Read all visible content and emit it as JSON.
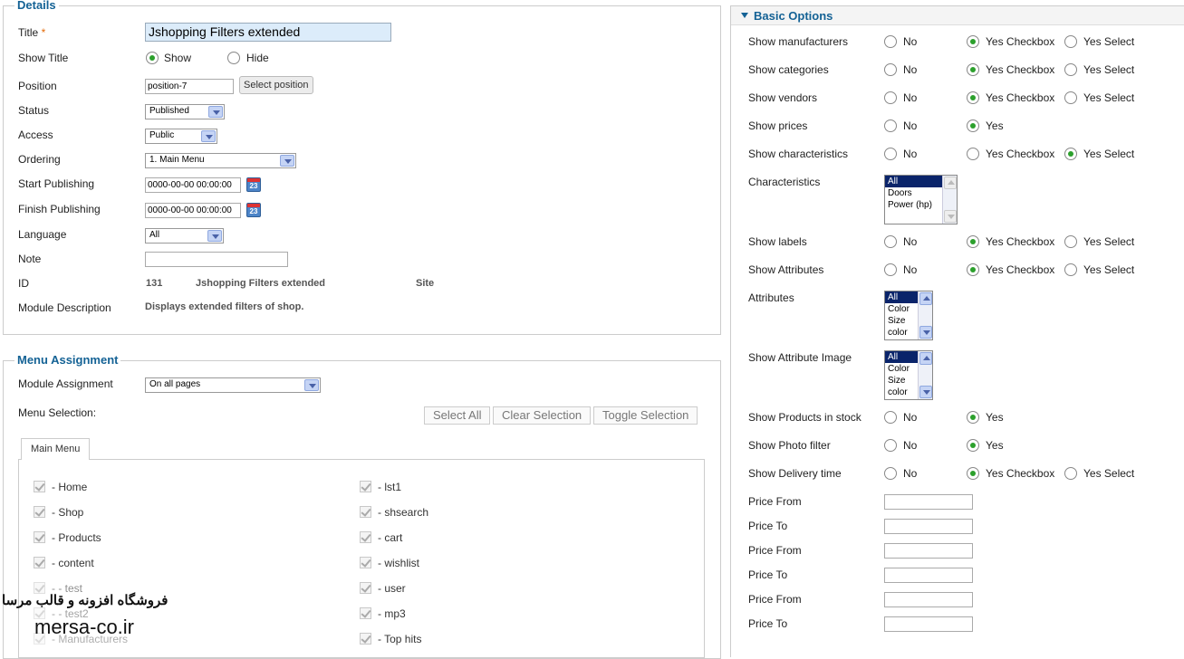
{
  "details": {
    "legend": "Details",
    "title_label": "Title",
    "title_required": "*",
    "title_value": "Jshopping Filters extended",
    "show_title_label": "Show Title",
    "show_option": "Show",
    "hide_option": "Hide",
    "position_label": "Position",
    "position_value": "position-7",
    "select_position_button": "Select position",
    "status_label": "Status",
    "status_value": "Published",
    "access_label": "Access",
    "access_value": "Public",
    "ordering_label": "Ordering",
    "ordering_value": "1. Main Menu",
    "start_label": "Start Publishing",
    "start_value": "0000-00-00 00:00:00",
    "finish_label": "Finish Publishing",
    "finish_value": "0000-00-00 00:00:00",
    "calendar_day": "23",
    "language_label": "Language",
    "language_value": "All",
    "note_label": "Note",
    "note_value": "",
    "id_label": "ID",
    "id_value": "131",
    "id_name": "Jshopping Filters extended",
    "id_site": "Site",
    "desc_label": "Module Description",
    "desc_value": "Displays extended filters of shop."
  },
  "menu_assignment": {
    "legend": "Menu Assignment",
    "module_assignment_label": "Module Assignment",
    "module_assignment_value": "On all pages",
    "menu_selection_label": "Menu Selection:",
    "select_all": "Select All",
    "clear_selection": "Clear Selection",
    "toggle_selection": "Toggle Selection",
    "tab_main_menu": "Main Menu",
    "left_items": [
      "- Home",
      "- Shop",
      "- Products",
      "- content",
      "- - test",
      "- - test2",
      "- Manufacturers"
    ],
    "right_items": [
      "- lst1",
      "- shsearch",
      "- cart",
      "- wishlist",
      "- user",
      "- mp3",
      "- Top hits"
    ]
  },
  "basic_options": {
    "title": "Basic Options",
    "rows": [
      {
        "label": "Show manufacturers",
        "no": "No",
        "yes": "Yes Checkbox",
        "select": "Yes Select",
        "selected": "yes"
      },
      {
        "label": "Show categories",
        "no": "No",
        "yes": "Yes Checkbox",
        "select": "Yes Select",
        "selected": "yes"
      },
      {
        "label": "Show vendors",
        "no": "No",
        "yes": "Yes Checkbox",
        "select": "Yes Select",
        "selected": "yes"
      },
      {
        "label": "Show prices",
        "no": "No",
        "yes": "Yes",
        "select": "",
        "selected": "yes"
      },
      {
        "label": "Show characteristics",
        "no": "No",
        "yes": "Yes Checkbox",
        "select": "Yes Select",
        "selected": "select"
      }
    ],
    "characteristics_label": "Characteristics",
    "characteristics_options": [
      "All",
      "Doors",
      "Power (hp)"
    ],
    "rows2": [
      {
        "label": "Show labels",
        "no": "No",
        "yes": "Yes Checkbox",
        "select": "Yes Select",
        "selected": "yes"
      },
      {
        "label": "Show Attributes",
        "no": "No",
        "yes": "Yes Checkbox",
        "select": "Yes Select",
        "selected": "yes"
      }
    ],
    "attributes_label": "Attributes",
    "attributes_options": [
      "All",
      "Color",
      "Size",
      "color"
    ],
    "attr_image_label": "Show Attribute Image",
    "attr_image_options": [
      "All",
      "Color",
      "Size",
      "color"
    ],
    "rows3": [
      {
        "label": "Show Products in stock",
        "no": "No",
        "yes": "Yes",
        "select": "",
        "selected": "yes"
      },
      {
        "label": "Show Photo filter",
        "no": "No",
        "yes": "Yes",
        "select": "",
        "selected": "yes"
      },
      {
        "label": "Show Delivery time",
        "no": "No",
        "yes": "Yes Checkbox",
        "select": "Yes Select",
        "selected": "yes"
      }
    ],
    "price_labels": [
      "Price From",
      "Price To",
      "Price From",
      "Price To",
      "Price From",
      "Price To"
    ]
  },
  "watermark": {
    "line1": "فروشگاه افزونه و قالب مرسا",
    "line2": "mersa-co.ir"
  }
}
